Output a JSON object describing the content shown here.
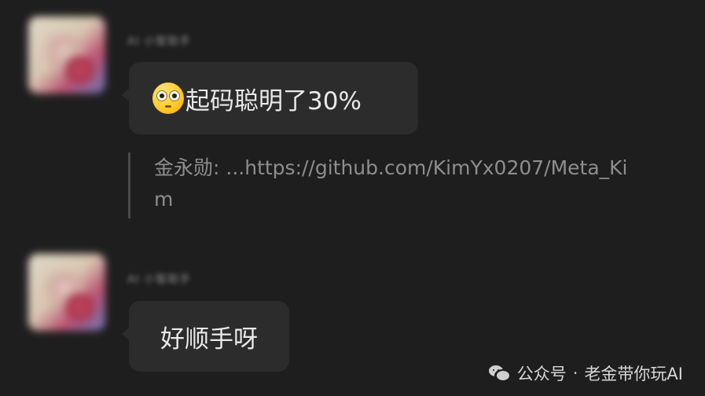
{
  "messages": [
    {
      "sender_name": "AI 小智助手",
      "emoji": "flushed-face-emoji",
      "text": "起码聪明了30%"
    },
    {
      "sender_name": "AI 小智助手",
      "text": "好顺手呀"
    }
  ],
  "quote": {
    "author": "金永勋",
    "separator": ": ",
    "content": "...https://github.com/KimYx0207/Meta_Kim"
  },
  "watermark": {
    "icon": "wechat-icon",
    "prefix": "公众号",
    "separator": "·",
    "name": "老金带你玩AI"
  },
  "colors": {
    "background": "#1e1e1e",
    "bubble": "#2c2c2c",
    "text": "#e9e9e9",
    "quote_text": "#8e8e8e"
  }
}
